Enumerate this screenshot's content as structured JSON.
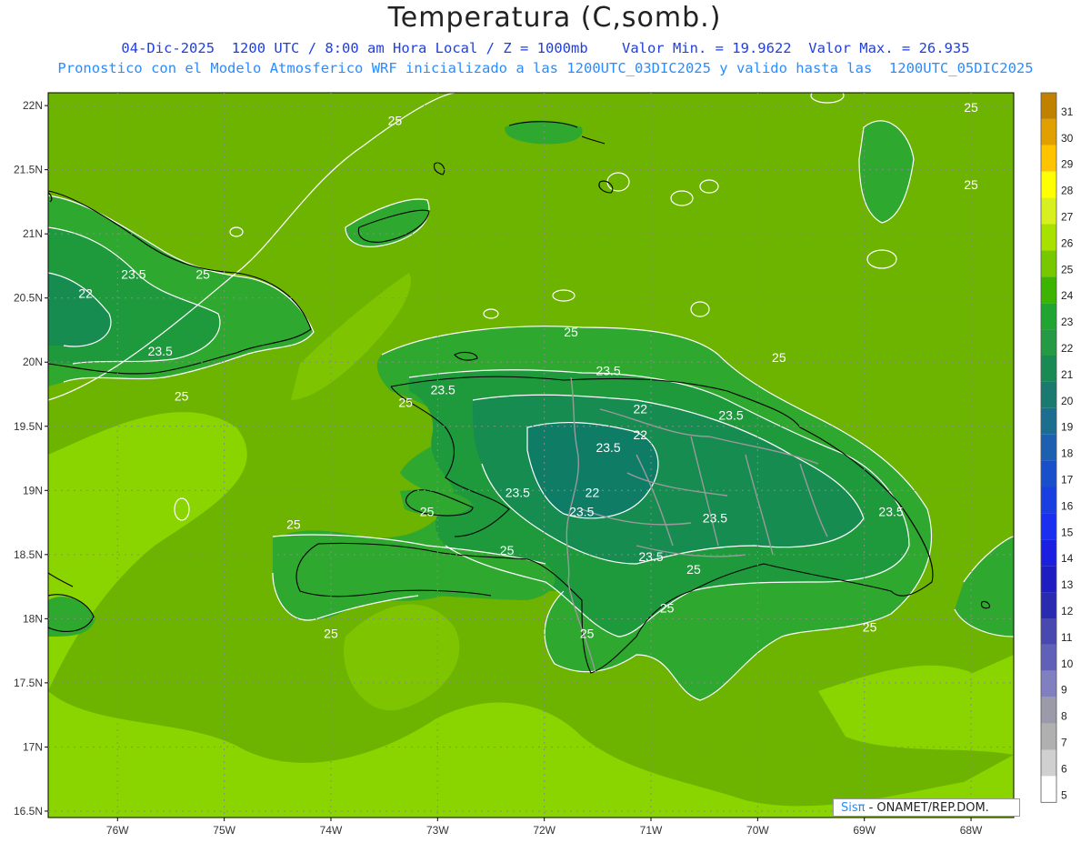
{
  "header": {
    "title": "Temperatura (C,somb.)",
    "line1": "04-Dic-2025  1200 UTC / 8:00 am Hora Local / Z = 1000mb    Valor Min. = 19.9622  Valor Max. = 26.935",
    "line2": "Pronostico con el Modelo Atmosferico WRF inicializado a las 1200UTC_03DIC2025 y valido hasta las  1200UTC_05DIC2025"
  },
  "axes": {
    "lat_labels": [
      "22N",
      "21.5N",
      "21N",
      "20.5N",
      "20N",
      "19.5N",
      "19N",
      "18.5N",
      "18N",
      "17.5N",
      "17N",
      "16.5N"
    ],
    "lon_labels": [
      "76W",
      "75W",
      "74W",
      "73W",
      "72W",
      "71W",
      "70W",
      "69W",
      "68W"
    ]
  },
  "contour_labels": [
    {
      "text": "25",
      "lon": -73.4,
      "lat": 21.85
    },
    {
      "text": "25",
      "lon": -68.0,
      "lat": 21.95
    },
    {
      "text": "25",
      "lon": -68.0,
      "lat": 21.35
    },
    {
      "text": "23.5",
      "lon": -75.85,
      "lat": 20.65
    },
    {
      "text": "25",
      "lon": -75.2,
      "lat": 20.65
    },
    {
      "text": "22",
      "lon": -76.3,
      "lat": 20.5
    },
    {
      "text": "23.5",
      "lon": -75.6,
      "lat": 20.05
    },
    {
      "text": "25",
      "lon": -75.4,
      "lat": 19.7
    },
    {
      "text": "25",
      "lon": -71.75,
      "lat": 20.2
    },
    {
      "text": "25",
      "lon": -69.8,
      "lat": 20.0
    },
    {
      "text": "23.5",
      "lon": -71.4,
      "lat": 19.9
    },
    {
      "text": "23.5",
      "lon": -72.95,
      "lat": 19.75
    },
    {
      "text": "25",
      "lon": -73.3,
      "lat": 19.65
    },
    {
      "text": "22",
      "lon": -71.1,
      "lat": 19.6
    },
    {
      "text": "23.5",
      "lon": -70.25,
      "lat": 19.55
    },
    {
      "text": "22",
      "lon": -71.1,
      "lat": 19.4
    },
    {
      "text": "23.5",
      "lon": -71.4,
      "lat": 19.3
    },
    {
      "text": "23.5",
      "lon": -72.25,
      "lat": 18.95
    },
    {
      "text": "22",
      "lon": -71.55,
      "lat": 18.95
    },
    {
      "text": "25",
      "lon": -73.1,
      "lat": 18.8
    },
    {
      "text": "23.5",
      "lon": -71.65,
      "lat": 18.8
    },
    {
      "text": "23.5",
      "lon": -68.75,
      "lat": 18.8
    },
    {
      "text": "23.5",
      "lon": -70.4,
      "lat": 18.75
    },
    {
      "text": "25",
      "lon": -74.35,
      "lat": 18.7
    },
    {
      "text": "25",
      "lon": -72.35,
      "lat": 18.5
    },
    {
      "text": "23.5",
      "lon": -71.0,
      "lat": 18.45
    },
    {
      "text": "25",
      "lon": -70.6,
      "lat": 18.35
    },
    {
      "text": "25",
      "lon": -70.85,
      "lat": 18.05
    },
    {
      "text": "25",
      "lon": -71.6,
      "lat": 17.85
    },
    {
      "text": "25",
      "lon": -74.0,
      "lat": 17.85
    },
    {
      "text": "25",
      "lon": -68.95,
      "lat": 17.9
    }
  ],
  "legend": {
    "levels": [
      "31",
      "30",
      "29",
      "28",
      "27",
      "26",
      "25",
      "24",
      "23",
      "22",
      "21",
      "20",
      "19",
      "18",
      "17",
      "16",
      "15",
      "14",
      "13",
      "12",
      "11",
      "10",
      "9",
      "8",
      "7",
      "6",
      "5"
    ],
    "colors": [
      "#c08000",
      "#e0a000",
      "#ffc400",
      "#ffff00",
      "#d8f020",
      "#a8e000",
      "#78c800",
      "#3cb400",
      "#20a530",
      "#249a45",
      "#1a8a55",
      "#1a7a70",
      "#1a6e90",
      "#1d5fb0",
      "#1a4fcc",
      "#1a3fe0",
      "#1a2ff0",
      "#1a1fe0",
      "#1e1ec0",
      "#2a2ab0",
      "#4848b0",
      "#6060b8",
      "#8080c0",
      "#9a9aa8",
      "#b0b0b0",
      "#d0d0d0",
      "#ffffff"
    ]
  },
  "credit": {
    "brand": "Sisπ",
    "text": " - ONAMET/REP.DOM."
  },
  "colors": {
    "sea_25_26": "#6db400",
    "warm_26_27": "#8ad400",
    "land_24_25": "#2fa82f",
    "land_23_24": "#1e9a3c",
    "land_22_23": "#168c50",
    "land_21_22": "#0f7d66",
    "coast": "#000000",
    "border": "#999999",
    "contour": "#ffffff"
  }
}
